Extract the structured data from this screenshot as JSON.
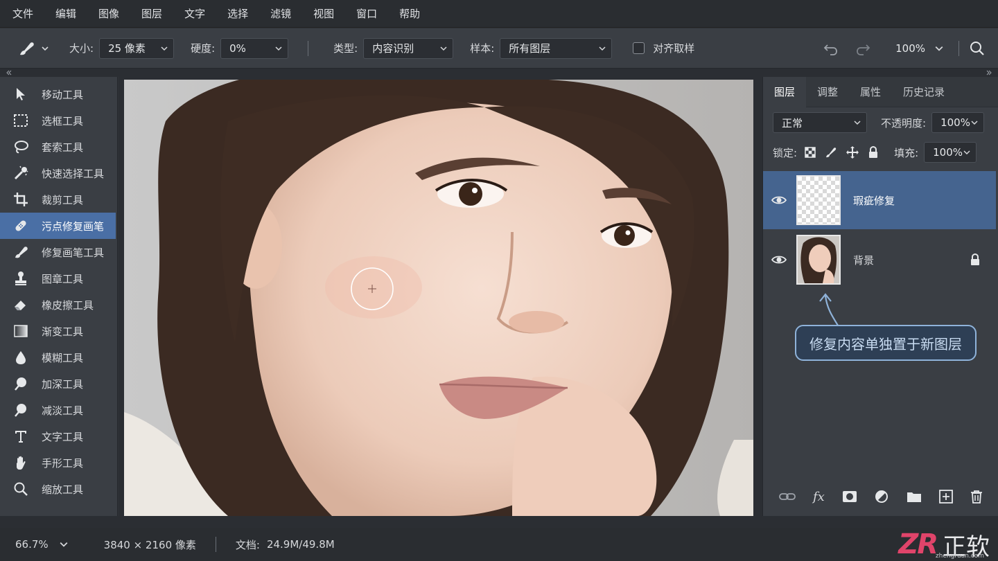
{
  "menu": [
    "文件",
    "编辑",
    "图像",
    "图层",
    "文字",
    "选择",
    "滤镜",
    "视图",
    "窗口",
    "帮助"
  ],
  "options": {
    "size_label": "大小:",
    "size_value": "25 像素",
    "hardness_label": "硬度:",
    "hardness_value": "0%",
    "type_label": "类型:",
    "type_value": "内容识别",
    "sample_label": "样本:",
    "sample_value": "所有图层",
    "align_label": "对齐取样",
    "zoom_value": "100%"
  },
  "tools": [
    {
      "label": "移动工具",
      "icon": "move-icon"
    },
    {
      "label": "选框工具",
      "icon": "marquee-icon"
    },
    {
      "label": "套索工具",
      "icon": "lasso-icon"
    },
    {
      "label": "快速选择工具",
      "icon": "quick-select-icon"
    },
    {
      "label": "裁剪工具",
      "icon": "crop-icon"
    },
    {
      "label": "污点修复画笔",
      "icon": "spot-healing-icon",
      "active": true
    },
    {
      "label": "修复画笔工具",
      "icon": "healing-brush-icon"
    },
    {
      "label": "图章工具",
      "icon": "stamp-icon"
    },
    {
      "label": "橡皮擦工具",
      "icon": "eraser-icon"
    },
    {
      "label": "渐变工具",
      "icon": "gradient-icon"
    },
    {
      "label": "模糊工具",
      "icon": "blur-icon"
    },
    {
      "label": "加深工具",
      "icon": "burn-icon"
    },
    {
      "label": "减淡工具",
      "icon": "dodge-icon"
    },
    {
      "label": "文字工具",
      "icon": "type-icon"
    },
    {
      "label": "手形工具",
      "icon": "hand-icon"
    },
    {
      "label": "缩放工具",
      "icon": "zoom-icon"
    }
  ],
  "panel": {
    "tabs": [
      "图层",
      "调整",
      "属性",
      "历史记录"
    ],
    "blend_mode": "正常",
    "opacity_label": "不透明度:",
    "opacity_value": "100%",
    "lock_label": "锁定:",
    "fill_label": "填充:",
    "fill_value": "100%",
    "layers": [
      {
        "name": "瑕疵修复",
        "selected": true
      },
      {
        "name": "背景",
        "locked": true
      }
    ],
    "callout": "修复内容单独置于新图层"
  },
  "status": {
    "zoom": "66.7%",
    "dimensions": "3840 × 2160 像素",
    "doc_label": "文档:",
    "doc_value": "24.9M/49.8M"
  },
  "watermark": {
    "brand_cn": "正软",
    "url": "zhengruan.com"
  },
  "colors": {
    "accent": "#4a6fa5",
    "selected_layer": "#45648f",
    "callout_border": "#8fb3da"
  }
}
